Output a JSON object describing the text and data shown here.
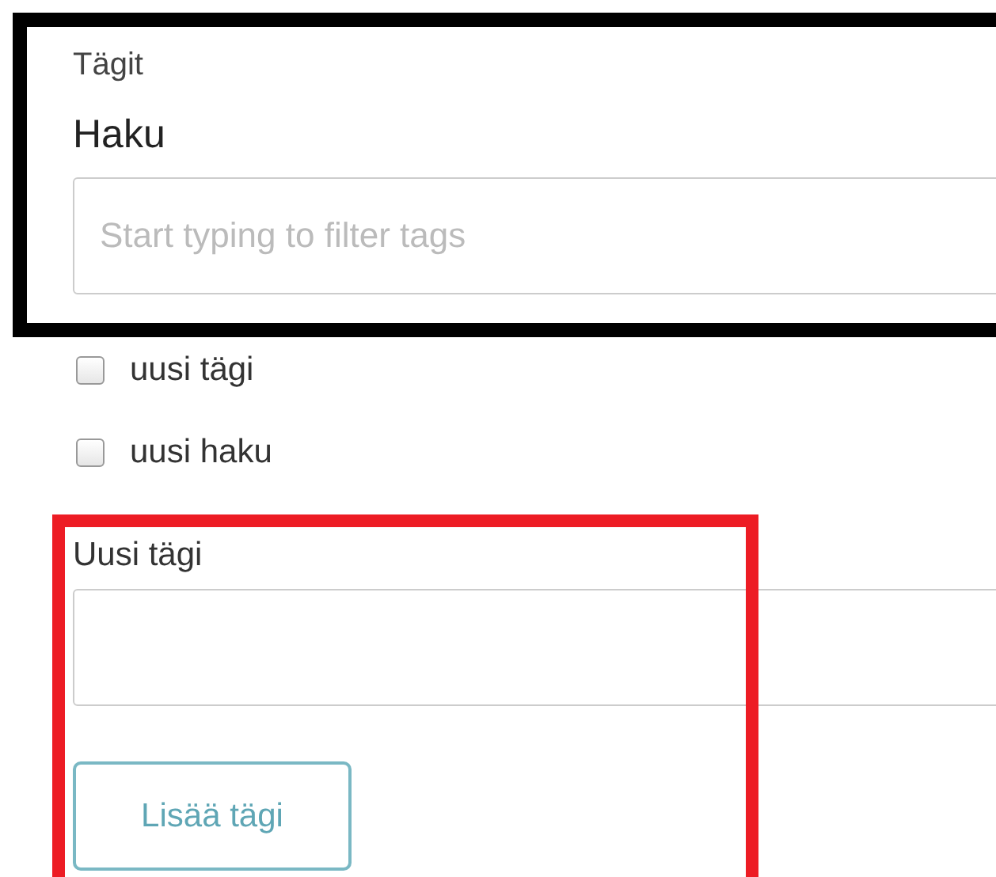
{
  "section": {
    "label": "Tägit"
  },
  "search": {
    "label": "Haku",
    "placeholder": "Start typing to filter tags"
  },
  "options": [
    {
      "label": "uusi tägi",
      "checked": false
    },
    {
      "label": "uusi haku",
      "checked": false
    }
  ],
  "new_tag": {
    "label": "Uusi tägi",
    "button": "Lisää tägi"
  },
  "highlights": [
    {
      "color": "#000000"
    },
    {
      "color": "#ed1c24"
    }
  ]
}
